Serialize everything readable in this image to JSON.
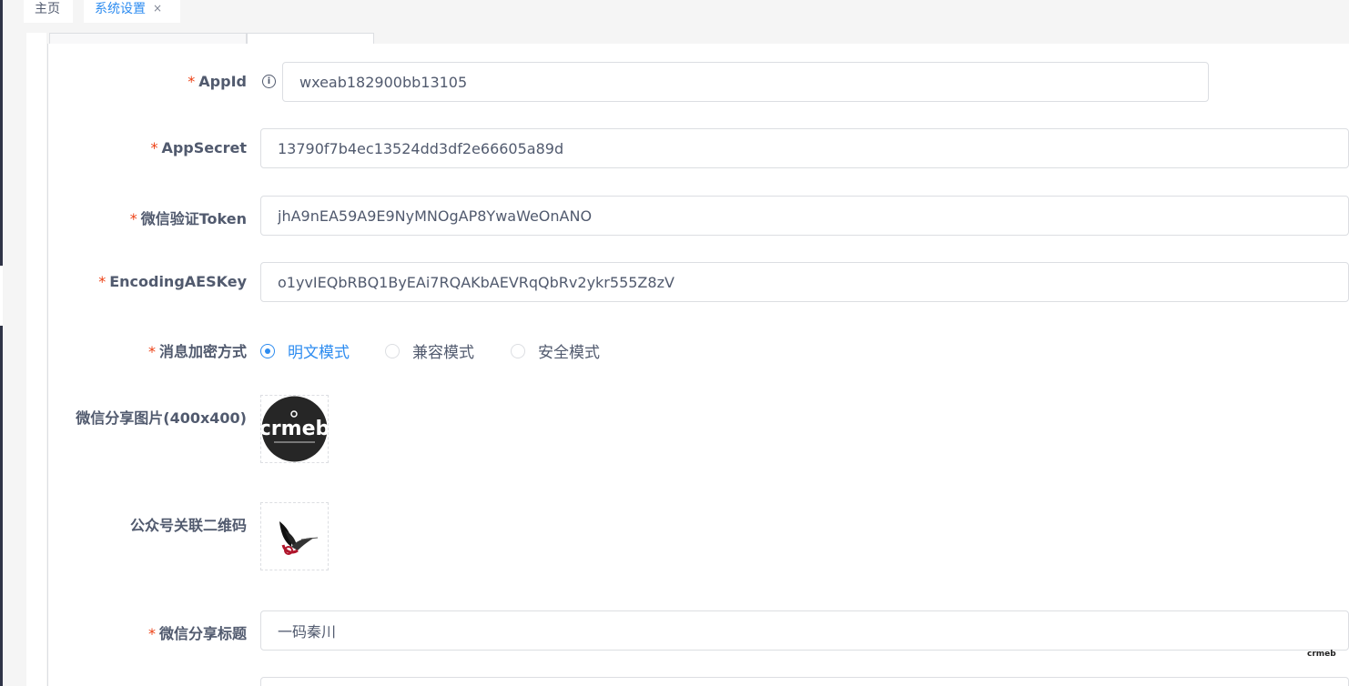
{
  "tabs": [
    {
      "label": "主页"
    },
    {
      "label": "系统设置",
      "close": "×"
    }
  ],
  "form": {
    "appid": {
      "label": "AppId",
      "value": "wxeab182900bb13105",
      "info": "i"
    },
    "appsecret": {
      "label": "AppSecret",
      "value": "13790f7b4ec13524dd3df2e66605a89d"
    },
    "token": {
      "label": "微信验证Token",
      "value": "jhA9nEA59A9E9NyMNOgAP8YwaWeOnANO"
    },
    "aeskey": {
      "label": "EncodingAESKey",
      "value": "o1yvIEQbRBQ1ByEAi7RQAKbAEVRqQbRv2ykr555Z8zV"
    },
    "encrypt": {
      "label": "消息加密方式",
      "options": [
        "明文模式",
        "兼容模式",
        "安全模式"
      ],
      "selected": "明文模式"
    },
    "share_image": {
      "label": "微信分享图片(400x400)",
      "image_text": "crmeb"
    },
    "qrcode": {
      "label": "公众号关联二维码"
    },
    "share_title": {
      "label": "微信分享标题",
      "value": "一码秦川"
    }
  },
  "required_mark": "*",
  "corner_logo": "crmeb",
  "colors": {
    "primary": "#2d8cf0",
    "required": "#ed4014",
    "text": "#515a6e",
    "border": "#dcdee2"
  }
}
